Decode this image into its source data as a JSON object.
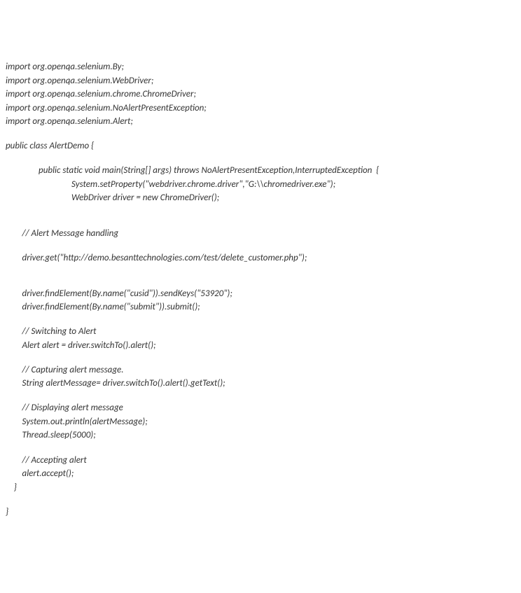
{
  "code": {
    "lines": [
      "import org.openqa.selenium.By;",
      "import org.openqa.selenium.WebDriver;",
      "import org.openqa.selenium.chrome.ChromeDriver;",
      "import org.openqa.selenium.NoAlertPresentException;",
      "import org.openqa.selenium.Alert;",
      "",
      "public class AlertDemo {",
      "",
      "                public static void main(String[] args) throws NoAlertPresentException,InterruptedException  {",
      "                                System.setProperty(\"webdriver.chrome.driver\",\"G:\\\\chromedriver.exe\");",
      "                                WebDriver driver = new ChromeDriver();",
      "",
      "",
      "        // Alert Message handling",
      "",
      "        driver.get(\"http://demo.besanttechnologies.com/test/delete_customer.php\");",
      "",
      "",
      "        driver.findElement(By.name(\"cusid\")).sendKeys(\"53920\");",
      "        driver.findElement(By.name(\"submit\")).submit();",
      "",
      "        // Switching to Alert",
      "        Alert alert = driver.switchTo().alert();",
      "",
      "        // Capturing alert message.",
      "        String alertMessage= driver.switchTo().alert().getText();",
      "",
      "        // Displaying alert message",
      "        System.out.println(alertMessage);",
      "        Thread.sleep(5000);",
      "",
      "        // Accepting alert",
      "        alert.accept();",
      "    }",
      "",
      "}"
    ]
  }
}
